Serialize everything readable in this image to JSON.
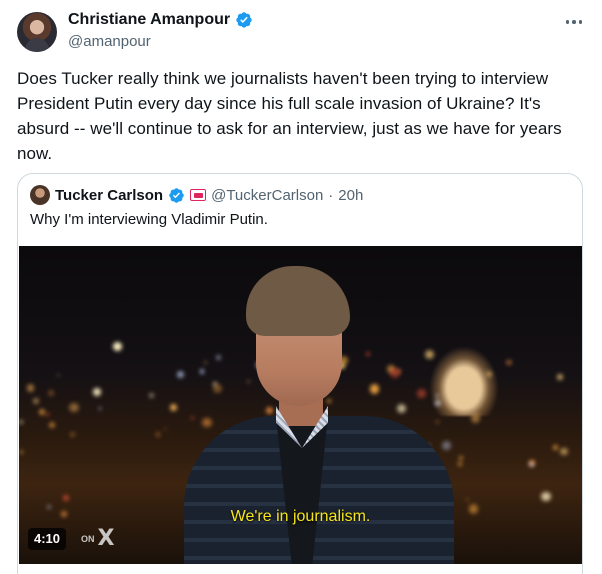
{
  "tweet": {
    "author": {
      "display_name": "Christiane Amanpour",
      "handle": "@amanpour",
      "verified_icon": "verified-badge-icon"
    },
    "more_icon": "more-horizontal-icon",
    "text": "Does Tucker really think we journalists haven't been trying to interview President Putin every day since his full scale invasion of Ukraine? It's absurd -- we'll continue to ask for an interview, just as we have for years now."
  },
  "quote": {
    "author": {
      "display_name": "Tucker Carlson",
      "handle": "@TuckerCarlson",
      "separator": "·",
      "time": "20h"
    },
    "text": "Why I'm interviewing Vladimir Putin.",
    "video": {
      "subtitle": "We're in journalism.",
      "duration": "4:10",
      "watermark_on": "ON",
      "watermark_x": "X"
    }
  },
  "colors": {
    "text_primary": "#0f1419",
    "text_secondary": "#536471",
    "verified_blue": "#1d9bf0",
    "border": "#cfd9de",
    "subtitle_yellow": "#f5e51a"
  }
}
